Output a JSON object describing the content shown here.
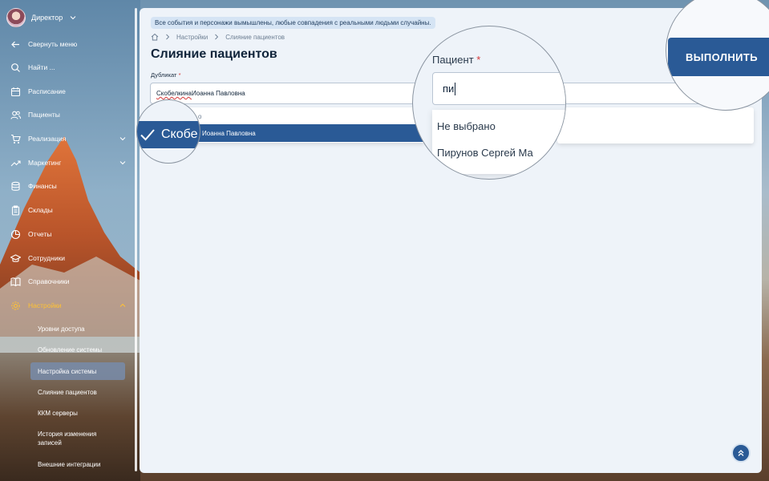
{
  "sidebar": {
    "profile_name": "Директор",
    "items": [
      {
        "label": "Свернуть меню",
        "icon": "arrow-left-icon"
      },
      {
        "label": "Найти ...",
        "icon": "search-icon"
      },
      {
        "label": "Расписание",
        "icon": "calendar-icon"
      },
      {
        "label": "Пациенты",
        "icon": "users-icon"
      },
      {
        "label": "Реализация",
        "icon": "cart-icon"
      },
      {
        "label": "Маркетинг",
        "icon": "trend-icon"
      },
      {
        "label": "Финансы",
        "icon": "database-icon"
      },
      {
        "label": "Склады",
        "icon": "clipboard-icon"
      },
      {
        "label": "Отчеты",
        "icon": "pie-chart-icon"
      },
      {
        "label": "Сотрудники",
        "icon": "graduation-cap-icon"
      },
      {
        "label": "Справочники",
        "icon": "book-icon"
      },
      {
        "label": "Настройки",
        "icon": "gear-icon"
      }
    ],
    "sub_items": [
      {
        "label": "Уровни доступа"
      },
      {
        "label": "Обновление системы"
      },
      {
        "label": "Настройка системы"
      },
      {
        "label": "Слияние пациентов"
      },
      {
        "label": "ККМ серверы"
      },
      {
        "label": "История изменения записей"
      },
      {
        "label": "Внешние интеграции"
      }
    ],
    "active_color": "#ffc233"
  },
  "main": {
    "notice": "Все события и персонажи вымышлены, любые совпадения с реальными людьми случайны.",
    "breadcrumb": [
      "Настройки",
      "Слияние пациентов"
    ],
    "title": "Слияние пациентов",
    "duplicate": {
      "label": "Дубликат",
      "required_mark": "*",
      "value_typo": "Скобелкина",
      "value_rest": " Иоанна Павловна",
      "dropdown_hint": "о",
      "selected_option": "Иоанна Павловна"
    }
  },
  "lens_left": {
    "text": "Скобе"
  },
  "lens_mid": {
    "label": "Пациент",
    "required_mark": "*",
    "typed": "пи",
    "options": [
      "Не выбрано",
      "Пирунов Сергей Ма"
    ]
  },
  "lens_right": {
    "button": "ВЫПОЛНИТЬ"
  },
  "colors": {
    "primary": "#2a5a96",
    "panel_bg": "#eef3f9",
    "required": "#d63a3a"
  }
}
